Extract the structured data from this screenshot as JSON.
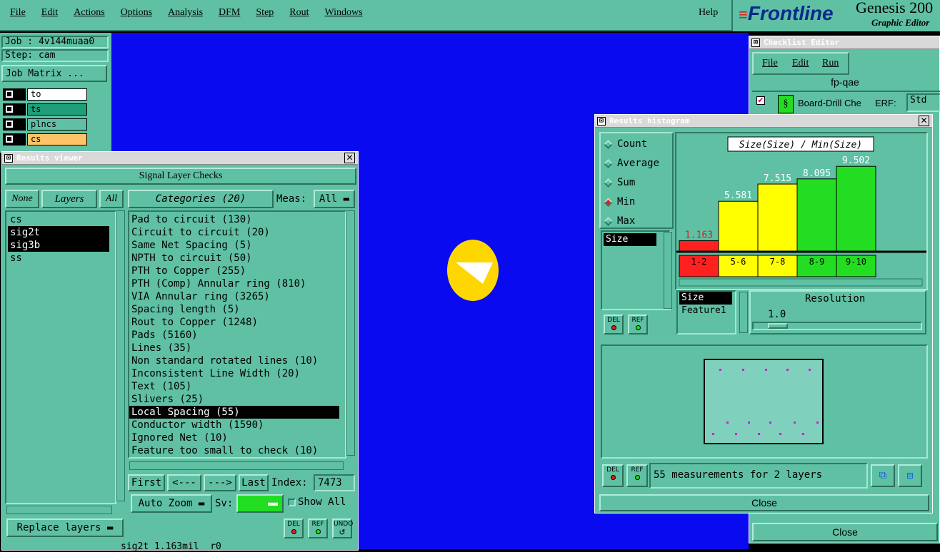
{
  "menubar": {
    "items": [
      "File",
      "Edit",
      "Actions",
      "Options",
      "Analysis",
      "DFM",
      "Step",
      "Rout",
      "Windows"
    ],
    "help": "Help"
  },
  "brand": {
    "logo": "Frontline",
    "product": "Genesis 200",
    "subtitle": "Graphic Editor"
  },
  "job_panel": {
    "job": "Job : 4v144muaa0",
    "step": "Step: cam",
    "matrix_button": "Job Matrix ...",
    "layers": [
      {
        "name": "to",
        "color": "#ffffff"
      },
      {
        "name": "ts",
        "color": "#1f9e7a"
      },
      {
        "name": "plncs",
        "color": "#5fc0a4"
      },
      {
        "name": "cs",
        "color": "#ffc266"
      }
    ]
  },
  "results_viewer": {
    "title": "Results viewer",
    "header": "Signal Layer Checks",
    "none_btn": "None",
    "layers_btn": "Layers",
    "all_btn": "All",
    "categories_btn": "Categories (20)",
    "meas_label": "Meas:",
    "meas_value": "All",
    "layers": [
      {
        "name": "cs",
        "selected": false
      },
      {
        "name": "sig2t",
        "selected": true
      },
      {
        "name": "sig3b",
        "selected": true
      },
      {
        "name": "ss",
        "selected": false
      }
    ],
    "categories": [
      {
        "label": "Pad to circuit (130)",
        "selected": false
      },
      {
        "label": "Circuit to circuit (20)",
        "selected": false
      },
      {
        "label": "Same Net Spacing (5)",
        "selected": false
      },
      {
        "label": "NPTH to circuit (50)",
        "selected": false
      },
      {
        "label": "PTH to Copper (255)",
        "selected": false
      },
      {
        "label": "PTH (Comp) Annular ring (810)",
        "selected": false
      },
      {
        "label": "VIA Annular ring (3265)",
        "selected": false
      },
      {
        "label": "Spacing length (5)",
        "selected": false
      },
      {
        "label": "Rout to Copper (1248)",
        "selected": false
      },
      {
        "label": "Pads (5160)",
        "selected": false
      },
      {
        "label": "Lines (35)",
        "selected": false
      },
      {
        "label": "Non standard rotated lines (10)",
        "selected": false
      },
      {
        "label": "Inconsistent Line Width (20)",
        "selected": false
      },
      {
        "label": "Text (105)",
        "selected": false
      },
      {
        "label": "Slivers (25)",
        "selected": false
      },
      {
        "label": "Local Spacing (55)",
        "selected": true
      },
      {
        "label": "Conductor width (1590)",
        "selected": false
      },
      {
        "label": "Ignored Net (10)",
        "selected": false
      },
      {
        "label": "Feature too small to check (10)",
        "selected": false
      }
    ],
    "first_btn": "First",
    "prev_btn": "<---",
    "next_btn": "--->",
    "last_btn": "Last",
    "index_label": "Index:",
    "index_value": "7473",
    "autozoom_btn": "Auto Zoom",
    "sv_label": "Sv:",
    "show_all_label": "Show All",
    "replace_layers_btn": "Replace layers",
    "del_label": "DEL",
    "ref_label": "REF",
    "undo_label": "UNDO",
    "status": "sig2t 1.163mil  r0"
  },
  "checklist_editor": {
    "title": "Checklist Editor",
    "menu": [
      "File",
      "Edit",
      "Run"
    ],
    "name": "fp-qae",
    "item": "Board-Drill Che",
    "erf_label": "ERF:",
    "erf_value": "Std",
    "close_btn": "Close"
  },
  "histogram": {
    "title": "Results histogram",
    "modes": [
      {
        "label": "Count",
        "selected": false
      },
      {
        "label": "Average",
        "selected": false
      },
      {
        "label": "Sum",
        "selected": false
      },
      {
        "label": "Min",
        "selected": true
      },
      {
        "label": "Max",
        "selected": false
      }
    ],
    "field_list": [
      "Size"
    ],
    "sort_list": [
      "Size",
      "Feature1"
    ],
    "resolution_label": "Resolution",
    "resolution_value": "1.0",
    "message": "55 measurements for 2 layers",
    "close_btn": "Close",
    "del_label": "DEL",
    "ref_label": "REF"
  },
  "chart_data": {
    "type": "bar",
    "title": "Size(Size) / Min(Size)",
    "categories": [
      "1-2",
      "5-6",
      "7-8",
      "8-9",
      "9-10"
    ],
    "values": [
      1.163,
      5.581,
      7.515,
      8.095,
      9.502
    ],
    "colors": [
      "#ff2020",
      "#ffff00",
      "#ffff00",
      "#22dd22",
      "#22dd22"
    ],
    "ylim": [
      0,
      10
    ],
    "grid": false
  }
}
